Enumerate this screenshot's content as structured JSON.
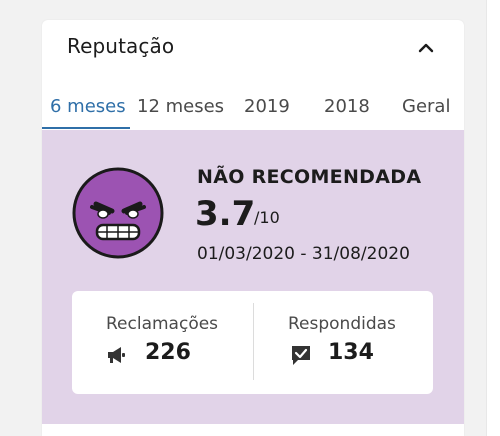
{
  "card": {
    "title": "Reputação"
  },
  "tabs": [
    {
      "label": "6 meses",
      "active": true
    },
    {
      "label": "12 meses",
      "active": false
    },
    {
      "label": "2019",
      "active": false
    },
    {
      "label": "2018",
      "active": false
    },
    {
      "label": "Geral",
      "active": false
    }
  ],
  "reputation": {
    "status": "NÃO RECOMENDADA",
    "score": "3.7",
    "score_max": "/10",
    "period": "01/03/2020 - 31/08/2020",
    "icon": "angry-face-icon"
  },
  "stats": {
    "complaints": {
      "label": "Reclamações",
      "value": "226",
      "icon": "megaphone-icon"
    },
    "answered": {
      "label": "Respondidas",
      "value": "134",
      "icon": "chat-check-icon"
    }
  },
  "colors": {
    "panel_background": "#e1d3e8",
    "face": "#9c53b2",
    "accent": "#2f6fa8"
  }
}
